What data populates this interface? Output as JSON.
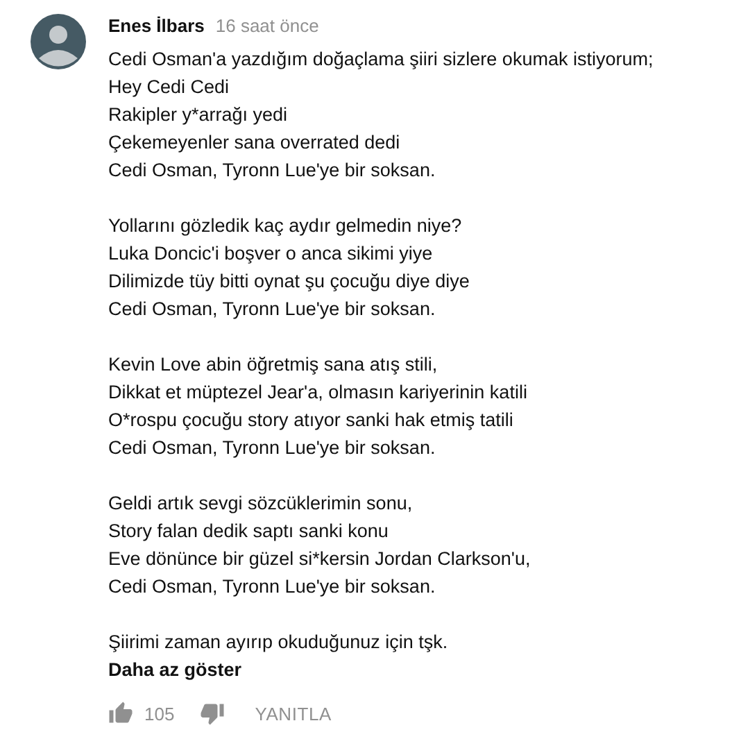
{
  "comment": {
    "author": "Enes İlbars",
    "time": "16 saat önce",
    "stanzas": [
      [
        "Cedi Osman'a yazdığım doğaçlama şiiri sizlere okumak istiyorum;",
        "Hey Cedi Cedi",
        "Rakipler y*arrağı yedi",
        "Çekemeyenler sana overrated dedi",
        "Cedi Osman, Tyronn Lue'ye bir soksan."
      ],
      [
        "Yollarını gözledik kaç aydır gelmedin niye?",
        "Luka Doncic'i boşver o anca sikimi yiye",
        "Dilimizde tüy bitti oynat şu çocuğu diye diye",
        "Cedi Osman, Tyronn Lue'ye bir soksan."
      ],
      [
        "Kevin Love abin öğretmiş sana atış stili,",
        "Dikkat et müptezel Jear'a, olmasın kariyerinin katili",
        "O*rospu çocuğu story atıyor sanki hak etmiş tatili",
        "Cedi Osman, Tyronn Lue'ye bir soksan."
      ],
      [
        "Geldi artık sevgi sözcüklerimin sonu,",
        "Story falan dedik saptı sanki konu",
        "Eve dönünce bir güzel si*kersin Jordan Clarkson'u,",
        "Cedi Osman, Tyronn Lue'ye bir soksan."
      ],
      [
        "Şiirimi zaman ayırıp okuduğunuz için tşk."
      ]
    ],
    "show_less": "Daha az göster",
    "likes": "105",
    "reply": "YANITLA"
  }
}
